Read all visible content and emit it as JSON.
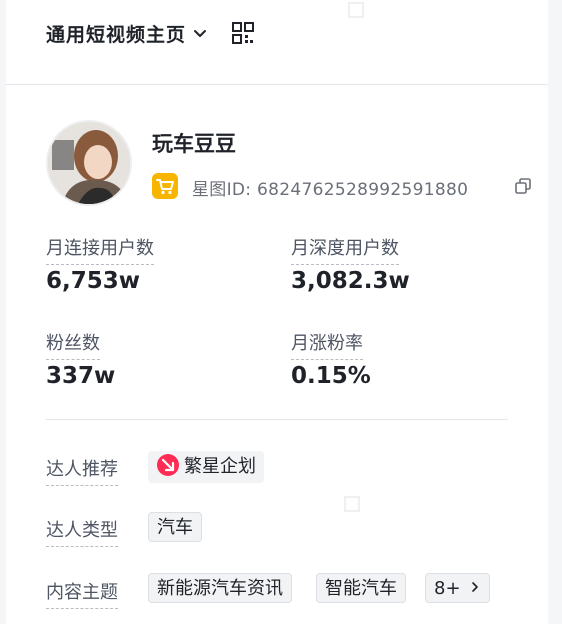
{
  "header": {
    "title": "通用短视频主页"
  },
  "profile": {
    "name": "玩车豆豆",
    "xingtu_id": "星图ID: 6824762528992591880"
  },
  "stats": [
    {
      "label": "月连接用户数",
      "value": "6,753w"
    },
    {
      "label": "月深度用户数",
      "value": "3,082.3w"
    },
    {
      "label": "粉丝数",
      "value": "337w"
    },
    {
      "label": "月涨粉率",
      "value": "0.15%"
    }
  ],
  "rows": {
    "recommend_label": "达人推荐",
    "recommend_tag": "繁星企划",
    "type_label": "达人类型",
    "type_tag": "汽车",
    "topic_label": "内容主题",
    "topic_tags": [
      "新能源汽车资讯",
      "智能汽车"
    ],
    "topic_more": "8+"
  },
  "colors": {
    "accent_badge": "#f7b500",
    "star_icon": "#fe2c55"
  },
  "icons": {
    "header": [
      "chevron-down-icon",
      "qr-code-icon"
    ],
    "profile": [
      "shopping-cart-icon",
      "copy-icon"
    ],
    "rows": [
      "star-plan-icon",
      "chevron-right-icon"
    ]
  }
}
